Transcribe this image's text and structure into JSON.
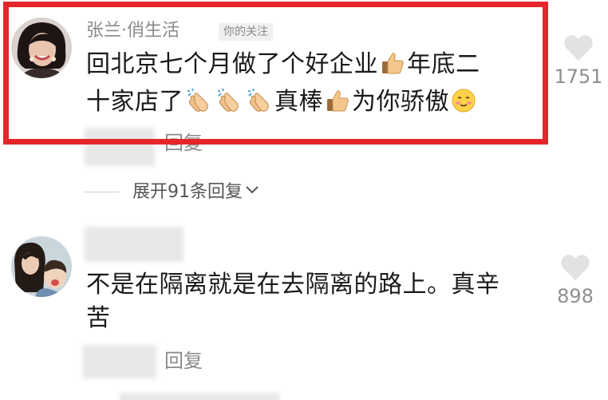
{
  "comments": [
    {
      "username": "张兰·俏生活",
      "follow_tag": "你的关注",
      "text_line1": "回北京七个月做了个好企业",
      "text_line1b": "年底二",
      "text_line2a": "十家店了",
      "text_line2b": "真棒",
      "text_line2c": "为你骄傲",
      "likes": "1751",
      "reply_label": "回复",
      "expand_label": "展开91条回复"
    },
    {
      "text_line1": "不是在隔离就是在去隔离的路上。真辛",
      "text_line2": "苦",
      "likes": "898",
      "reply_label": "回复"
    }
  ],
  "icons": {
    "thumbs_up": "thumbs-up-emoji",
    "clap": "clapping-hands-emoji",
    "smile": "blushing-smile-emoji",
    "heart": "heart-icon"
  },
  "colors": {
    "highlight": "#e4262a",
    "meta_text": "#8a8a8a"
  }
}
